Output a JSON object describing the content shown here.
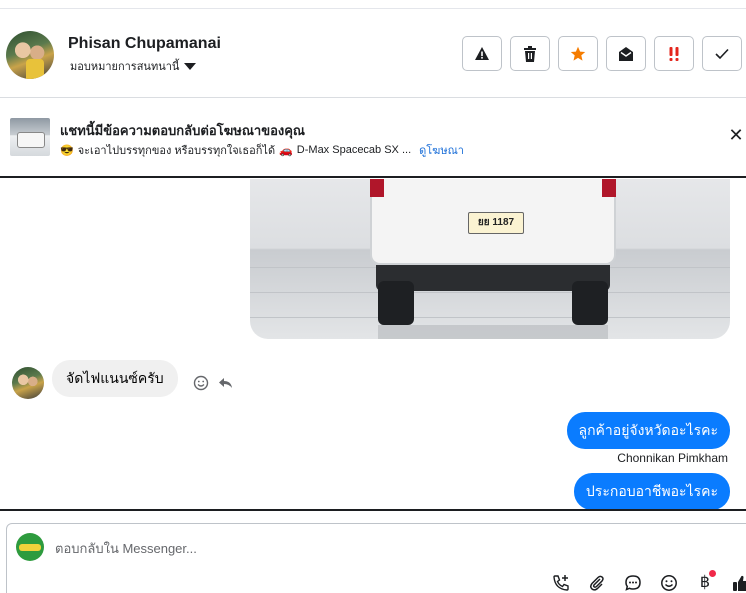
{
  "header": {
    "customer_name": "Phisan Chupamanai",
    "assign_label": "มอบหมายการสนทนานี้",
    "actions": [
      {
        "icon": "warning-icon"
      },
      {
        "icon": "trash-icon"
      },
      {
        "icon": "star-icon",
        "color": "#f57c00"
      },
      {
        "icon": "mail-open-icon"
      },
      {
        "icon": "exclamation-icon",
        "color": "#e4251b"
      },
      {
        "icon": "check-icon"
      }
    ]
  },
  "ad_banner": {
    "title": "แชทนี้มีข้อความตอบกลับต่อโฆษณาของคุณ",
    "emoji1": "😎",
    "text": "จะเอาไปบรรทุกของ หรือบรรทุกใจเธอก็ได้",
    "emoji2": "🚗",
    "product": "D-Max Spacecab SX ...",
    "link": "ดูโฆษณา"
  },
  "conversation": {
    "image": {
      "plate": "ยย 1187"
    },
    "incoming": [
      {
        "text": "จัดไฟแนนซ์ครับ"
      }
    ],
    "outgoing": [
      {
        "text": "ลูกค้าอยู่จังหวัดอะไรคะ"
      },
      {
        "text": "ประกอบอาชีพอะไรคะ"
      }
    ],
    "sender_name": "Chonnikan Pimkham"
  },
  "composer": {
    "placeholder": "ตอบกลับใน Messenger...",
    "tools": [
      "call-add-icon",
      "attachment-icon",
      "chat-bubble-icon",
      "emoji-icon",
      "baht-icon",
      "thumbs-up-icon"
    ],
    "baht_symbol": "฿"
  },
  "colors": {
    "accent_blue": "#0a7cff",
    "link_blue": "#1a6ed8",
    "star_orange": "#f57c00",
    "alert_red": "#e4251b",
    "notif_red": "#f02849"
  }
}
